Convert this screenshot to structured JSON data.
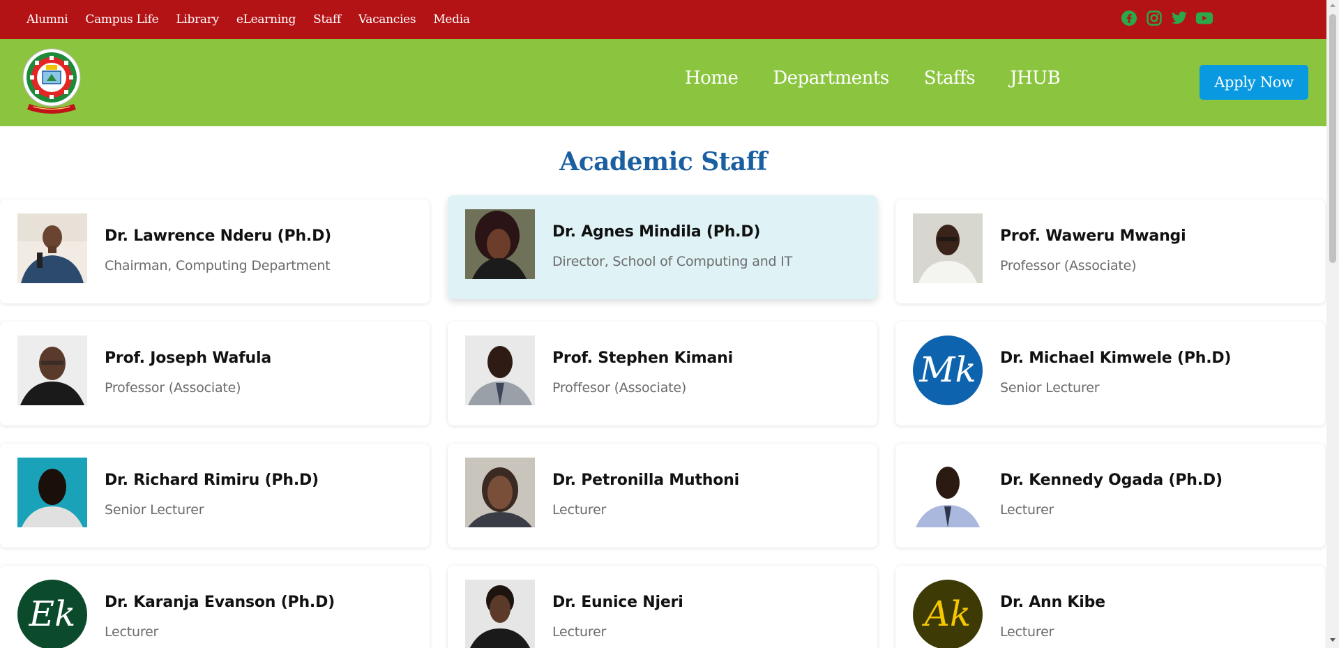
{
  "top_nav": {
    "links": [
      "Alumni",
      "Campus Life",
      "Library",
      "eLearning",
      "Staff",
      "Vacancies",
      "Media"
    ],
    "social_icons": [
      "facebook-icon",
      "instagram-icon",
      "twitter-icon",
      "youtube-icon"
    ],
    "social_color": "#2aa84a"
  },
  "main_nav": {
    "links": [
      "Home",
      "Departments",
      "Staffs",
      "JHUB"
    ],
    "apply_label": "Apply Now"
  },
  "colors": {
    "top_bar": "#b41316",
    "main_bar": "#8bc540",
    "accent_button": "#0999e0",
    "title": "#1a5f9f",
    "highlight_card": "#dff3f6"
  },
  "page_title": "Academic Staff",
  "staff": [
    {
      "name": "Dr. Lawrence Nderu (Ph.D)",
      "role": "Chairman, Computing Department",
      "avatar": "photo"
    },
    {
      "name": "Dr. Agnes Mindila (Ph.D)",
      "role": "Director, School of Computing and IT",
      "avatar": "photo",
      "highlighted": true
    },
    {
      "name": "Prof. Waweru Mwangi",
      "role": "Professor (Associate)",
      "avatar": "photo"
    },
    {
      "name": "Prof. Joseph Wafula",
      "role": "Professor (Associate)",
      "avatar": "photo"
    },
    {
      "name": "Prof. Stephen Kimani",
      "role": "Proffesor (Associate)",
      "avatar": "photo"
    },
    {
      "name": "Dr. Michael Kimwele (Ph.D)",
      "role": "Senior Lecturer",
      "avatar": "initials",
      "initials": "Mk",
      "avatar_color": "#0d63ad",
      "initials_color": "#ffffff"
    },
    {
      "name": "Dr. Richard Rimiru (Ph.D)",
      "role": "Senior Lecturer",
      "avatar": "photo"
    },
    {
      "name": "Dr. Petronilla Muthoni",
      "role": "Lecturer",
      "avatar": "photo"
    },
    {
      "name": "Dr. Kennedy Ogada (Ph.D)",
      "role": "Lecturer",
      "avatar": "photo"
    },
    {
      "name": "Dr. Karanja Evanson (Ph.D)",
      "role": "Lecturer",
      "avatar": "initials",
      "initials": "Ek",
      "avatar_color": "#0c4a2c",
      "initials_color": "#ffffff"
    },
    {
      "name": "Dr. Eunice Njeri",
      "role": "Lecturer",
      "avatar": "photo"
    },
    {
      "name": "Dr. Ann Kibe",
      "role": "Lecturer",
      "avatar": "initials",
      "initials": "Ak",
      "avatar_color": "#3d3a05",
      "initials_color": "#f5c800"
    }
  ]
}
